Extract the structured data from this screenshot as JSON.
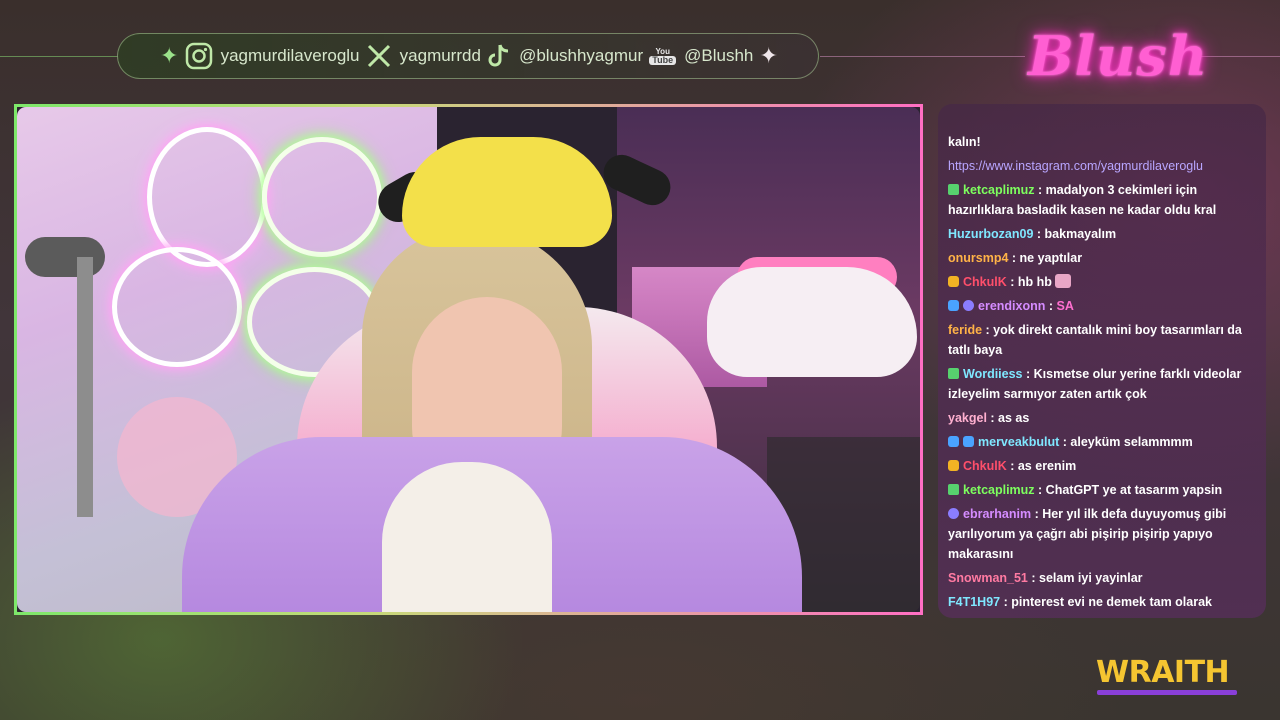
{
  "social": {
    "instagram": "yagmurdilaveroglu",
    "x": "yagmurrdd",
    "tiktok": "@blushhyagmur",
    "youtube_badge_top": "You",
    "youtube_badge_bottom": "Tube",
    "youtube": "@Blushh"
  },
  "logo": {
    "text": "Blush",
    "color": "#ff5fd2"
  },
  "brand": {
    "sponsor": "WRAITH",
    "sponsor_color": "#f5c531"
  },
  "chat": {
    "messages": [
      {
        "user": "",
        "user_color": "#ffffff",
        "text": "kalın!",
        "badges": []
      },
      {
        "user": "",
        "user_color": "#ffffff",
        "text": "https://www.instagram.com/yagmurdilaveroglu",
        "is_link": true,
        "badges": []
      },
      {
        "user": "ketcaplimuz",
        "user_color": "#7dff5e",
        "text": "madalyon 3 cekimleri için hazırlıklara basladik kasen ne kadar oldu kral",
        "badges": [
          "green"
        ]
      },
      {
        "user": "Huzurbozan09",
        "user_color": "#7fe7ff",
        "text": "bakmayalım",
        "badges": []
      },
      {
        "user": "onursmp4",
        "user_color": "#ffb347",
        "text": "ne yaptılar",
        "badges": []
      },
      {
        "user": "ChkulK",
        "user_color": "#ff4f6b",
        "text": "hb hb",
        "badges": [
          "crown"
        ],
        "emote": true
      },
      {
        "user": "erendixonn",
        "user_color": "#d58cff",
        "text": "SA",
        "text_color": "#ff6fd0",
        "badges": [
          "blue",
          "purple"
        ]
      },
      {
        "user": "feride",
        "user_color": "#ffb347",
        "text": "yok direkt cantalık mini boy tasarımları da tatlı baya",
        "badges": []
      },
      {
        "user": "Wordiiess",
        "user_color": "#7fe7ff",
        "text": "Kısmetse olur yerine farklı videolar izleyelim sarmıyor zaten artık çok",
        "badges": [
          "green"
        ]
      },
      {
        "user": "yakgel",
        "user_color": "#ffb0d0",
        "text": "as as",
        "badges": []
      },
      {
        "user": "merveakbulut",
        "user_color": "#7fe7ff",
        "text": "aleyküm selammmm",
        "badges": [
          "blue",
          "blue"
        ]
      },
      {
        "user": "ChkulK",
        "user_color": "#ff4f6b",
        "text": "as erenim",
        "badges": [
          "crown"
        ]
      },
      {
        "user": "ketcaplimuz",
        "user_color": "#7dff5e",
        "text": "ChatGPT ye at tasarım yapsin",
        "badges": [
          "green"
        ]
      },
      {
        "user": "ebrarhanim",
        "user_color": "#d58cff",
        "text": "Her yıl ilk defa duyuyomuş gibi yarılıyorum ya çağrı abi pişirip pişirip yapıyo makarasını",
        "badges": [
          "purple"
        ]
      },
      {
        "user": "Snowman_51",
        "user_color": "#ff7aa2",
        "text": "selam iyi yayinlar",
        "badges": []
      },
      {
        "user": "F4T1H97",
        "user_color": "#7fe7ff",
        "text": "pinterest evi ne demek tam olarak",
        "badges": []
      }
    ]
  }
}
